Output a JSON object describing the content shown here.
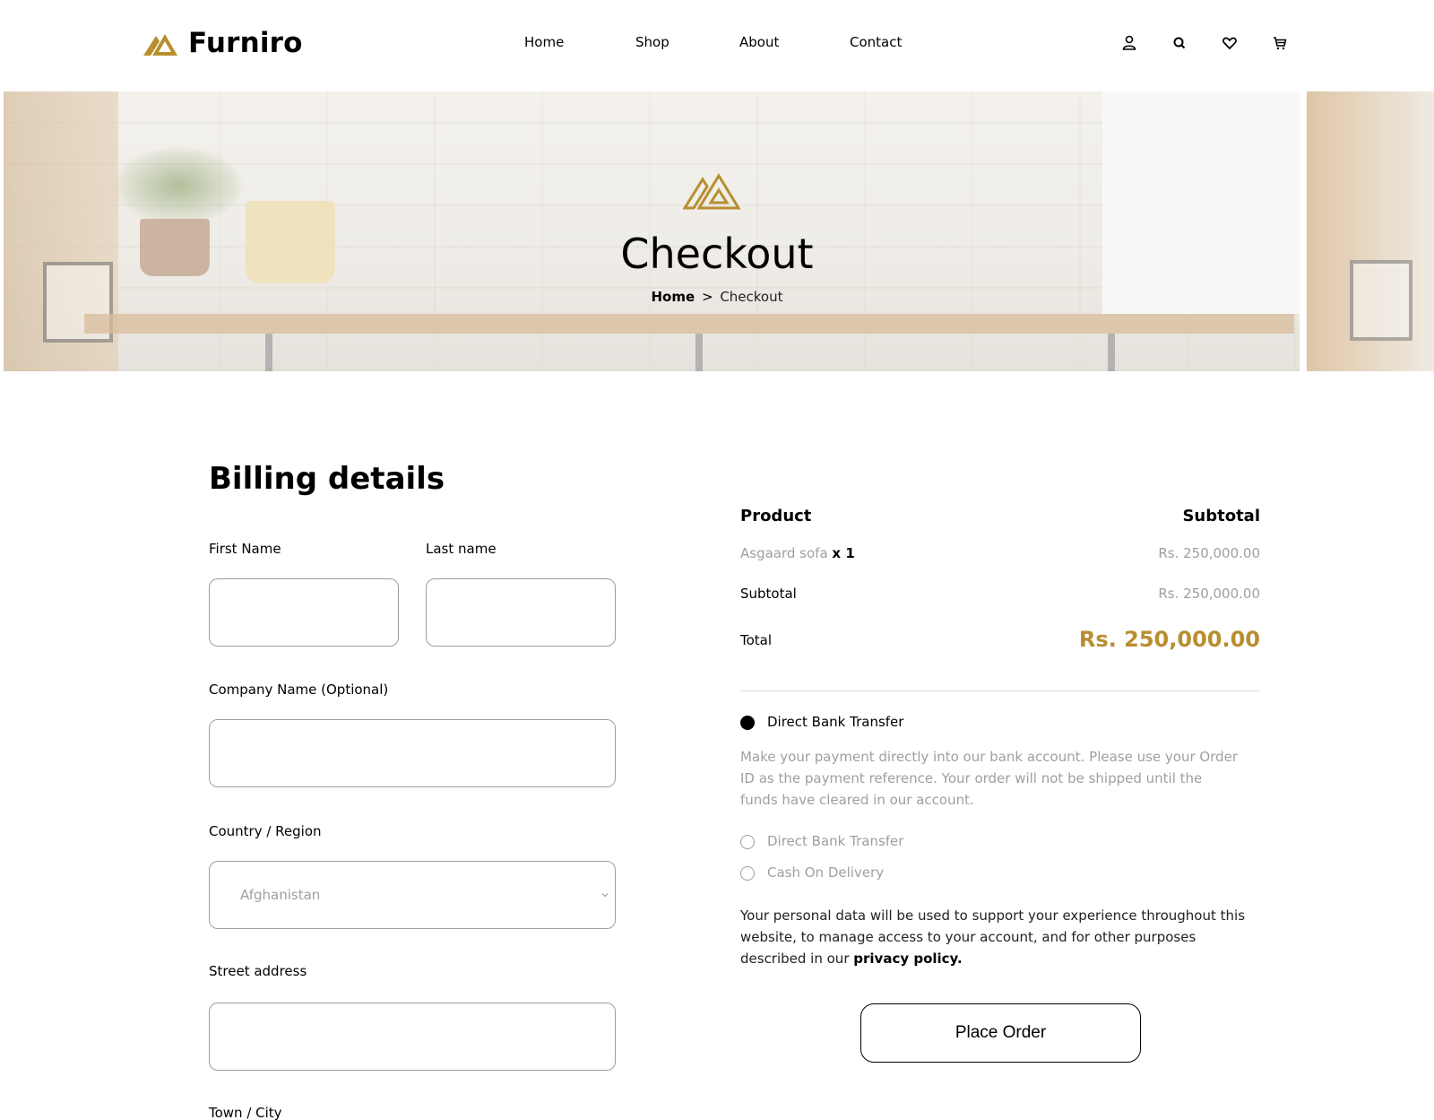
{
  "brand": {
    "name": "Furniro",
    "accent_color": "#B88E2F"
  },
  "nav": {
    "items": [
      "Home",
      "Shop",
      "About",
      "Contact"
    ]
  },
  "header_icons": [
    "user-icon",
    "search-icon",
    "heart-icon",
    "cart-icon"
  ],
  "hero": {
    "title": "Checkout",
    "breadcrumb": {
      "home": "Home",
      "separator": ">",
      "current": "Checkout"
    }
  },
  "billing": {
    "title": "Billing details",
    "first_name_label": "First Name",
    "first_name_value": "",
    "last_name_label": "Last name",
    "last_name_value": "",
    "company_label": "Company Name (Optional)",
    "company_value": "",
    "country_label": "Country / Region",
    "country_value": "Afghanistan",
    "street_label": "Street address",
    "street_value": "",
    "town_label": "Town / City"
  },
  "order": {
    "product_header": "Product",
    "subtotal_header": "Subtotal",
    "product_name": "Asgaard sofa",
    "product_qty": "x 1",
    "product_price": "Rs. 250,000.00",
    "subtotal_label": "Subtotal",
    "subtotal_value": "Rs. 250,000.00",
    "total_label": "Total",
    "total_value": "Rs. 250,000.00"
  },
  "payment": {
    "selected_label": "Direct Bank Transfer",
    "description": "Make your payment directly into our bank account. Please use your Order ID as the payment reference. Your order will not be shipped until the funds have cleared in our account.",
    "options": [
      "Direct Bank Transfer",
      "Cash On Delivery"
    ]
  },
  "privacy": {
    "text": "Your personal data will be used to support your experience throughout this website, to manage access to your account, and for other purposes described in our",
    "link": "privacy policy."
  },
  "place_order_label": "Place Order"
}
